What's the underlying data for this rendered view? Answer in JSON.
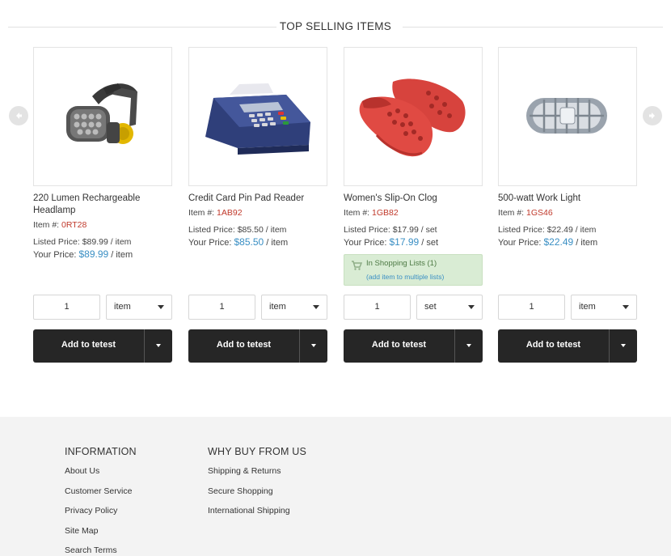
{
  "section": {
    "title": "TOP SELLING ITEMS"
  },
  "carousel": {
    "prev_icon": "chevron-left-icon",
    "next_icon": "chevron-right-icon"
  },
  "products": [
    {
      "name": "220 Lumen Rechargeable Headlamp",
      "item_label": "Item #:",
      "item_code": "0RT28",
      "listed_label": "Listed Price:",
      "listed_price": "$89.99",
      "listed_unit": "/ item",
      "your_label": "Your Price:",
      "your_price": "$89.99",
      "your_unit": "/ item",
      "image": "headlamp-image",
      "qty": "1",
      "unit": "item",
      "add_label": "Add to tetest"
    },
    {
      "name": "Credit Card Pin Pad Reader",
      "item_label": "Item #:",
      "item_code": "1AB92",
      "listed_label": "Listed Price:",
      "listed_price": "$85.50",
      "listed_unit": "/ item",
      "your_label": "Your Price:",
      "your_price": "$85.50",
      "your_unit": "/ item",
      "image": "card-reader-image",
      "qty": "1",
      "unit": "item",
      "add_label": "Add to tetest"
    },
    {
      "name": "Women's Slip-On Clog",
      "item_label": "Item #:",
      "item_code": "1GB82",
      "listed_label": "Listed Price:",
      "listed_price": "$17.99",
      "listed_unit": "/ set",
      "your_label": "Your Price:",
      "your_price": "$17.99",
      "your_unit": "/ set",
      "image": "clog-image",
      "shopping_lists": "In Shopping Lists (1)",
      "add_multiple": "(add item to multiple lists)",
      "qty": "1",
      "unit": "set",
      "add_label": "Add to tetest"
    },
    {
      "name": "500-watt Work Light",
      "item_label": "Item #:",
      "item_code": "1GS46",
      "listed_label": "Listed Price:",
      "listed_price": "$22.49",
      "listed_unit": "/ item",
      "your_label": "Your Price:",
      "your_price": "$22.49",
      "your_unit": "/ item",
      "image": "work-light-image",
      "qty": "1",
      "unit": "item",
      "add_label": "Add to tetest"
    }
  ],
  "footer": {
    "info": {
      "title": "INFORMATION",
      "links": [
        "About Us",
        "Customer Service",
        "Privacy Policy",
        "Site Map",
        "Search Terms"
      ]
    },
    "why": {
      "title": "WHY BUY FROM US",
      "links": [
        "Shipping & Returns",
        "Secure Shopping",
        "International Shipping"
      ]
    }
  },
  "colors": {
    "accent": "#3a8fc4",
    "item_code": "#c0392b",
    "button": "#262626",
    "footer_bg": "#f3f3f3",
    "list_badge": "#d9ecd4"
  }
}
